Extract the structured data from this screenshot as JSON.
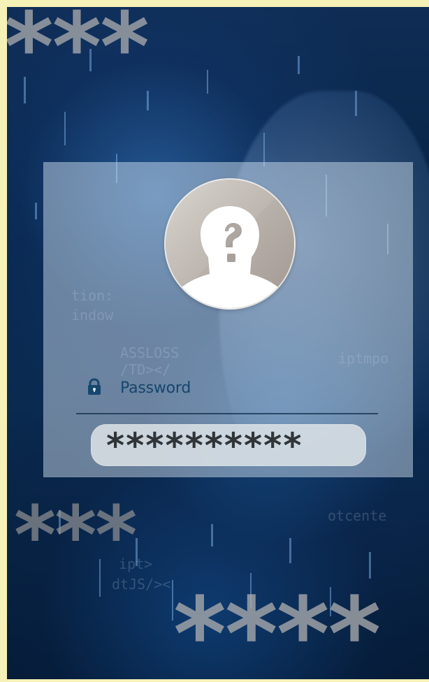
{
  "background": {
    "decorative_asterisks": {
      "top": "***",
      "middle": "***",
      "bottom": "****"
    },
    "colors": {
      "frame": "#f6f1b7",
      "scene_dark": "#062344",
      "scene_accent": "#3b7fd0",
      "panel_text": "#16466c"
    }
  },
  "login_card": {
    "avatar_icon": "unknown-user-icon",
    "lock_icon": "lock-icon",
    "password_label": "Password",
    "password_value": "**********"
  }
}
